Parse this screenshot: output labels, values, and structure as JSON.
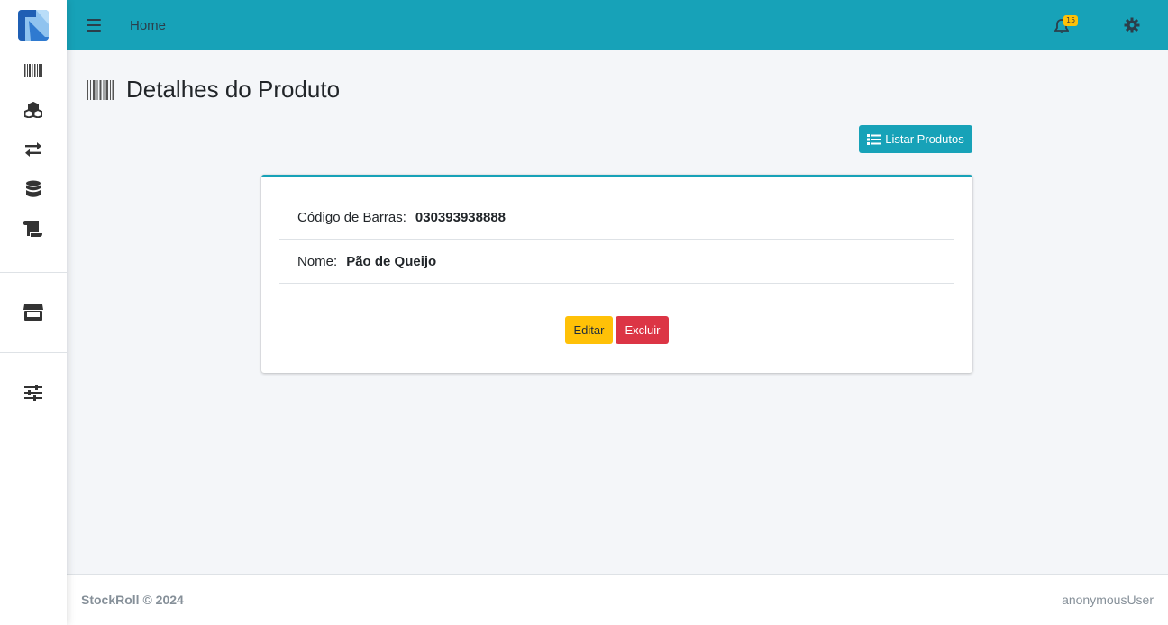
{
  "topbar": {
    "home_label": "Home",
    "notification_count": "15"
  },
  "sidebar": {
    "items": [
      {
        "icon": "barcode-icon"
      },
      {
        "icon": "boxes-icon"
      },
      {
        "icon": "exchange-icon"
      },
      {
        "icon": "database-icon"
      },
      {
        "icon": "scroll-icon"
      },
      {
        "icon": "store-icon"
      },
      {
        "icon": "sliders-icon"
      }
    ]
  },
  "page": {
    "title": "Detalhes do Produto",
    "list_button_label": "Listar Produtos"
  },
  "product": {
    "barcode_label": "Código de Barras:",
    "barcode_value": "030393938888",
    "name_label": "Nome:",
    "name_value": "Pão de Queijo"
  },
  "actions": {
    "edit_label": "Editar",
    "delete_label": "Excluir"
  },
  "footer": {
    "brand": "StockRoll © 2024",
    "user": "anonymousUser"
  },
  "colors": {
    "primary": "#17a2b8",
    "warning": "#ffc107",
    "danger": "#dc3545"
  }
}
